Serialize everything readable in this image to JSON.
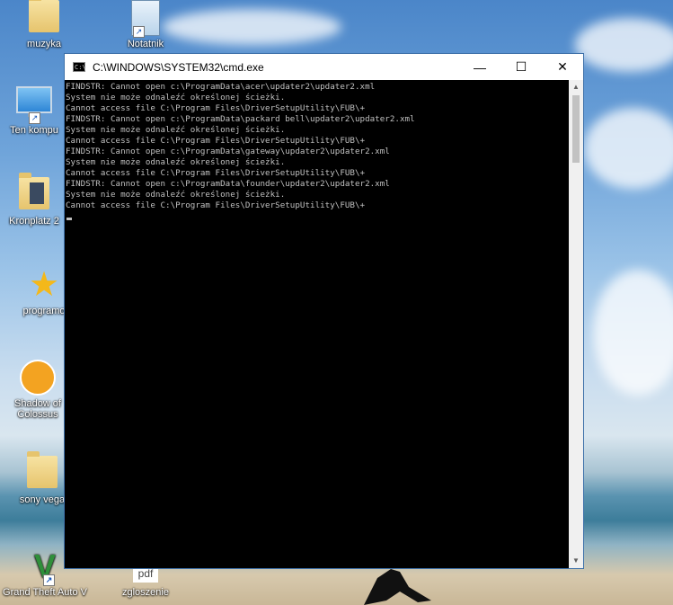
{
  "desktop": {
    "icons": [
      {
        "label": "muzyka",
        "icon": "music-folder-icon"
      },
      {
        "label": "Notatnik",
        "icon": "notepad-icon"
      },
      {
        "label": "Ten kompu",
        "icon": "computer-icon"
      },
      {
        "label": "Kronplatz 2",
        "icon": "photo-folder-icon"
      },
      {
        "label": "programo",
        "icon": "star-icon"
      },
      {
        "label": "Shadow of",
        "label2": "Colossus",
        "icon": "sheep-game-icon"
      },
      {
        "label": "sony vega",
        "icon": "folder-icon"
      },
      {
        "label": "Grand Theft Auto V",
        "icon": "gta-icon"
      },
      {
        "label": "zgloszenie",
        "icon": "pdf-file-icon",
        "badge": "pdf"
      }
    ]
  },
  "window": {
    "title": "C:\\WINDOWS\\SYSTEM32\\cmd.exe",
    "minimize": "—",
    "maximize": "☐",
    "close": "✕",
    "console_lines": [
      "FINDSTR: Cannot open c:\\ProgramData\\acer\\updater2\\updater2.xml",
      "System nie może odnaleźć określonej ścieżki.",
      "Cannot access file C:\\Program Files\\DriverSetupUtility\\FUB\\+",
      "FINDSTR: Cannot open c:\\ProgramData\\packard bell\\updater2\\updater2.xml",
      "System nie może odnaleźć określonej ścieżki.",
      "Cannot access file C:\\Program Files\\DriverSetupUtility\\FUB\\+",
      "FINDSTR: Cannot open c:\\ProgramData\\gateway\\updater2\\updater2.xml",
      "System nie może odnaleźć określonej ścieżki.",
      "Cannot access file C:\\Program Files\\DriverSetupUtility\\FUB\\+",
      "FINDSTR: Cannot open c:\\ProgramData\\founder\\updater2\\updater2.xml",
      "System nie może odnaleźć określonej ścieżki.",
      "Cannot access file C:\\Program Files\\DriverSetupUtility\\FUB\\+"
    ]
  }
}
